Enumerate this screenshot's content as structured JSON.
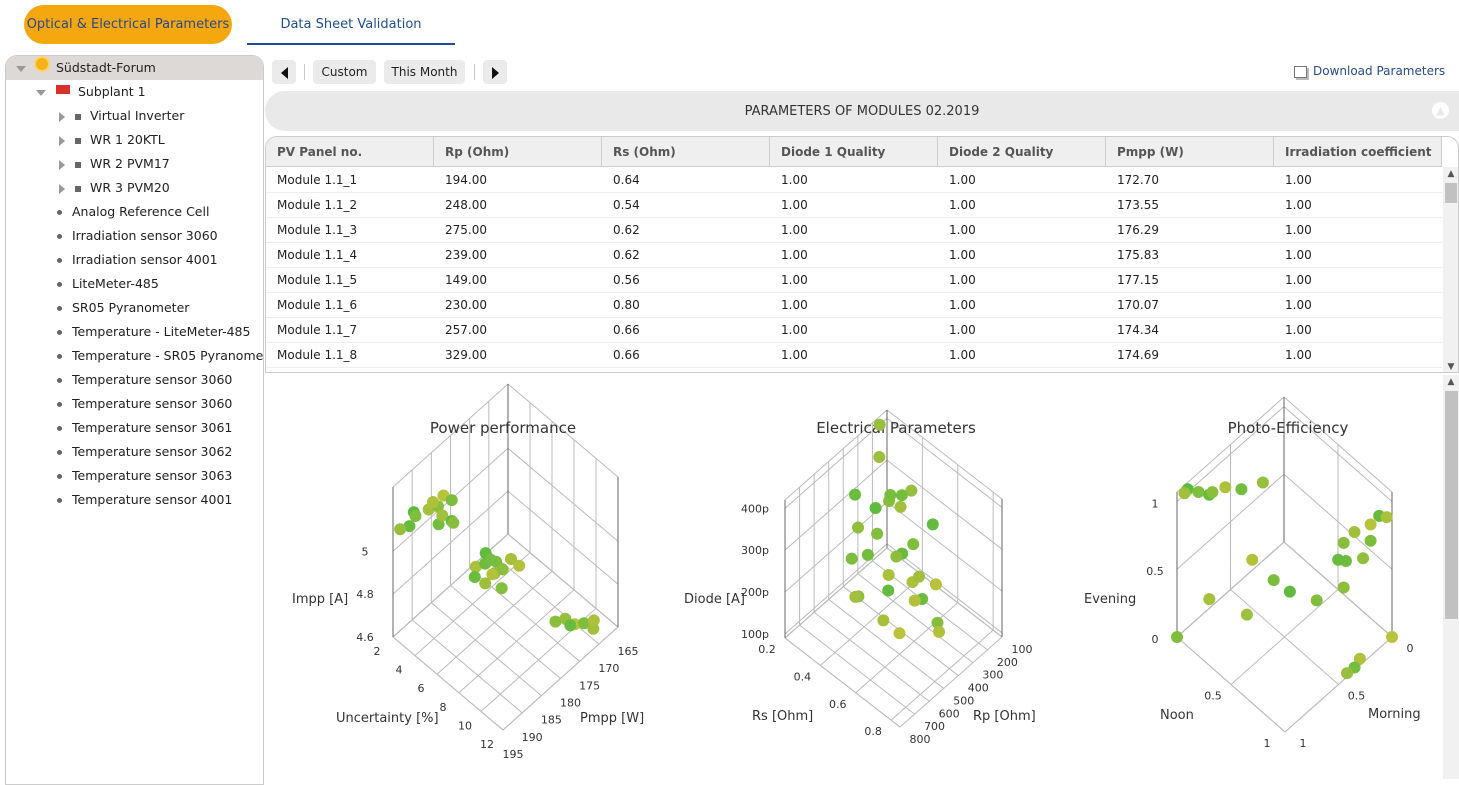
{
  "tabs": [
    {
      "label": "Optical & Electrical Parameters",
      "active": true
    },
    {
      "label": "Data Sheet Validation",
      "active": false
    }
  ],
  "tree": {
    "root": "Südstadt-Forum",
    "subplant": "Subplant 1",
    "inverters": [
      "Virtual Inverter",
      "WR 1 20KTL",
      "WR 2 PVM17",
      "WR 3 PVM20"
    ],
    "sensors": [
      "Analog Reference Cell",
      "Irradiation sensor 3060",
      "Irradiation sensor 4001",
      "LiteMeter-485",
      "SR05 Pyranometer",
      "Temperature - LiteMeter-485",
      "Temperature - SR05 Pyranometer",
      "Temperature sensor 3060",
      "Temperature sensor 3060",
      "Temperature sensor 3061",
      "Temperature sensor 3062",
      "Temperature sensor 3063",
      "Temperature sensor 4001"
    ]
  },
  "toolbar": {
    "custom": "Custom",
    "this_month": "This Month",
    "download": "Download Parameters"
  },
  "banner": "PARAMETERS OF MODULES 02.2019",
  "table": {
    "columns": [
      "PV Panel no.",
      "Rp (Ohm)",
      "Rs (Ohm)",
      "Diode 1 Quality",
      "Diode 2 Quality",
      "Pmpp (W)",
      "Irradiation coefficient"
    ],
    "rows": [
      [
        "Module 1.1_1",
        "194.00",
        "0.64",
        "1.00",
        "1.00",
        "172.70",
        "1.00"
      ],
      [
        "Module 1.1_2",
        "248.00",
        "0.54",
        "1.00",
        "1.00",
        "173.55",
        "1.00"
      ],
      [
        "Module 1.1_3",
        "275.00",
        "0.62",
        "1.00",
        "1.00",
        "176.29",
        "1.00"
      ],
      [
        "Module 1.1_4",
        "239.00",
        "0.62",
        "1.00",
        "1.00",
        "175.83",
        "1.00"
      ],
      [
        "Module 1.1_5",
        "149.00",
        "0.56",
        "1.00",
        "1.00",
        "177.15",
        "1.00"
      ],
      [
        "Module 1.1_6",
        "230.00",
        "0.80",
        "1.00",
        "1.00",
        "170.07",
        "1.00"
      ],
      [
        "Module 1.1_7",
        "257.00",
        "0.66",
        "1.00",
        "1.00",
        "174.34",
        "1.00"
      ],
      [
        "Module 1.1_8",
        "329.00",
        "0.66",
        "1.00",
        "1.00",
        "174.69",
        "1.00"
      ]
    ]
  },
  "colors": {
    "accent": "#f5a70f",
    "link": "#2a4a8a",
    "point_green": "#5dbb3e",
    "point_yellow": "#bcc23c"
  },
  "chart_data": [
    {
      "type": "scatter3d",
      "title": "Power performance",
      "x": {
        "label": "Uncertainty [%]",
        "range": [
          2,
          12
        ],
        "ticks": [
          2,
          4,
          6,
          8,
          10,
          12
        ],
        "tick_labels": [
          "2",
          "4",
          "6",
          "8",
          "10",
          "12"
        ]
      },
      "y": {
        "label": "Pmpp [W]",
        "range": [
          165,
          195
        ],
        "ticks": [
          165,
          170,
          175,
          180,
          185,
          190,
          195
        ],
        "tick_labels": [
          "165",
          "170",
          "175",
          "180",
          "185",
          "190",
          "195"
        ]
      },
      "z": {
        "label": "Impp [A]",
        "range": [
          4.6,
          5.3
        ],
        "ticks": [
          4.6,
          4.8,
          5.0
        ],
        "tick_labels": [
          "4.6",
          "4.8",
          "5"
        ]
      },
      "points": [
        [
          2.5,
          191,
          5.14
        ],
        [
          3,
          192,
          5.16
        ],
        [
          3.5,
          190,
          5.18
        ],
        [
          2.8,
          193,
          5.12
        ],
        [
          4,
          189,
          5.2
        ],
        [
          3.2,
          188,
          5.17
        ],
        [
          4.4,
          190,
          5.15
        ],
        [
          2.3,
          194,
          5.1
        ],
        [
          3.8,
          187,
          5.21
        ],
        [
          4.2,
          186,
          5.19
        ],
        [
          3,
          185,
          5.05
        ],
        [
          3.5,
          184,
          5.03
        ],
        [
          4,
          185,
          5.06
        ],
        [
          5,
          182,
          4.85
        ],
        [
          5.5,
          181,
          4.87
        ],
        [
          6,
          180,
          4.83
        ],
        [
          6.5,
          182,
          4.88
        ],
        [
          5.8,
          179,
          4.86
        ],
        [
          6.2,
          183,
          4.84
        ],
        [
          5.2,
          180,
          4.89
        ],
        [
          7,
          181,
          4.82
        ],
        [
          6.8,
          178,
          4.9
        ],
        [
          5.6,
          184,
          4.86
        ],
        [
          6.4,
          179,
          4.85
        ],
        [
          7.2,
          177,
          4.87
        ],
        [
          6,
          181,
          4.91
        ],
        [
          10,
          173,
          4.68
        ],
        [
          10.5,
          172,
          4.66
        ],
        [
          11,
          171,
          4.67
        ],
        [
          11.5,
          170,
          4.65
        ],
        [
          10.8,
          174,
          4.7
        ],
        [
          9.8,
          175,
          4.69
        ],
        [
          11.2,
          169,
          4.66
        ]
      ]
    },
    {
      "type": "scatter3d",
      "title": "Electrical Parameters",
      "x": {
        "label": "Rs [Ohm]",
        "range": [
          0.2,
          0.85
        ],
        "ticks": [
          0.2,
          0.4,
          0.6,
          0.8
        ],
        "tick_labels": [
          "0.2",
          "0.4",
          "0.6",
          "0.8"
        ]
      },
      "y": {
        "label": "Rp [Ohm]",
        "range": [
          100,
          800
        ],
        "ticks": [
          100,
          200,
          300,
          400,
          500,
          600,
          700,
          800
        ],
        "tick_labels": [
          "100",
          "200",
          "300",
          "400",
          "500",
          "600",
          "700",
          "800"
        ]
      },
      "z": {
        "label": "Diode [A]",
        "range": [
          90,
          420
        ],
        "ticks": [
          100,
          200,
          300,
          400
        ],
        "tick_labels": [
          "100p",
          "200p",
          "300p",
          "400p"
        ]
      },
      "points": [
        [
          0.3,
          300,
          280
        ],
        [
          0.35,
          350,
          250
        ],
        [
          0.4,
          250,
          300
        ],
        [
          0.45,
          300,
          220
        ],
        [
          0.5,
          400,
          260
        ],
        [
          0.55,
          350,
          200
        ],
        [
          0.38,
          450,
          240
        ],
        [
          0.42,
          200,
          330
        ],
        [
          0.6,
          250,
          180
        ],
        [
          0.33,
          500,
          230
        ],
        [
          0.48,
          220,
          150
        ],
        [
          0.52,
          480,
          210
        ],
        [
          0.36,
          280,
          310
        ],
        [
          0.44,
          380,
          190
        ],
        [
          0.58,
          320,
          160
        ],
        [
          0.3,
          420,
          270
        ],
        [
          0.62,
          420,
          200
        ],
        [
          0.4,
          320,
          350
        ],
        [
          0.28,
          250,
          380
        ],
        [
          0.5,
          150,
          260
        ],
        [
          0.65,
          300,
          120
        ],
        [
          0.55,
          550,
          170
        ],
        [
          0.25,
          380,
          320
        ],
        [
          0.45,
          600,
          210
        ],
        [
          0.7,
          350,
          130
        ],
        [
          0.35,
          180,
          290
        ],
        [
          0.2,
          150,
          400
        ],
        [
          0.6,
          500,
          140
        ],
        [
          0.48,
          260,
          240
        ],
        [
          0.4,
          560,
          180
        ]
      ]
    },
    {
      "type": "scatter3d",
      "title": "Photo-Efficiency",
      "x": {
        "label": "Noon",
        "range": [
          0,
          1
        ],
        "ticks": [
          0,
          0.5,
          1
        ],
        "tick_labels": [
          "",
          "0.5",
          "1"
        ]
      },
      "y": {
        "label": "Morning",
        "range": [
          0,
          1
        ],
        "ticks": [
          0,
          0.5,
          1
        ],
        "tick_labels": [
          "0",
          "0.5",
          "1"
        ]
      },
      "z": {
        "label": "Evening",
        "range": [
          0,
          1.07
        ],
        "ticks": [
          0,
          0.5,
          1
        ],
        "tick_labels": [
          "0",
          "0.5",
          "1"
        ]
      },
      "points": [
        [
          0,
          0.9,
          1.02
        ],
        [
          0.05,
          0.85,
          1.0
        ],
        [
          0.02,
          0.95,
          1.04
        ],
        [
          0.1,
          0.8,
          0.98
        ],
        [
          0.08,
          0.75,
          0.95
        ],
        [
          0.15,
          0.7,
          1.0
        ],
        [
          0.2,
          0.6,
          0.95
        ],
        [
          0.3,
          0.5,
          1.0
        ],
        [
          0.95,
          0.15,
          0.9
        ],
        [
          1,
          0.2,
          0.85
        ],
        [
          0.9,
          0.25,
          0.88
        ],
        [
          0.98,
          0.1,
          0.95
        ],
        [
          0.85,
          0.3,
          0.8
        ],
        [
          1,
          0.05,
          0.92
        ],
        [
          0.92,
          0.35,
          0.75
        ],
        [
          0.95,
          0.22,
          0.7
        ],
        [
          0.3,
          0.6,
          0.5
        ],
        [
          0.4,
          0.5,
          0.35
        ],
        [
          0.35,
          0.7,
          0.2
        ],
        [
          0.5,
          0.45,
          0.3
        ],
        [
          0.6,
          0.3,
          0.2
        ],
        [
          0.2,
          0.9,
          0.35
        ],
        [
          0.7,
          0.2,
          0.5
        ],
        [
          0.8,
          0.25,
          0.4
        ],
        [
          1,
          0.3,
          0.05
        ],
        [
          1,
          0.35,
          0.02
        ],
        [
          0.98,
          0.4,
          0
        ],
        [
          1,
          0,
          0
        ],
        [
          0,
          1,
          0
        ]
      ]
    }
  ]
}
